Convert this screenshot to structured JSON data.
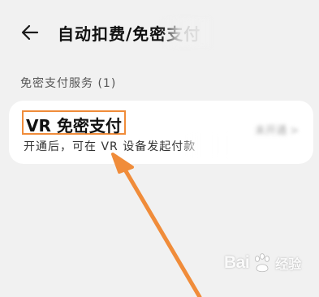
{
  "header": {
    "back_icon": "arrow-left-icon",
    "title": "自动扣费/免密支付"
  },
  "section": {
    "title": "免密支付服务 (1)"
  },
  "service_item": {
    "title": "VR 免密支付",
    "description": "开通后，可在 VR 设备发起付款",
    "status": "未开通 >"
  },
  "annotation": {
    "highlight_color": "#f08c3a",
    "arrow_color": "#f08c3a"
  },
  "watermark": {
    "brand": "Bai",
    "paw_icon": "baidu-paw-icon",
    "sub": "经验"
  }
}
